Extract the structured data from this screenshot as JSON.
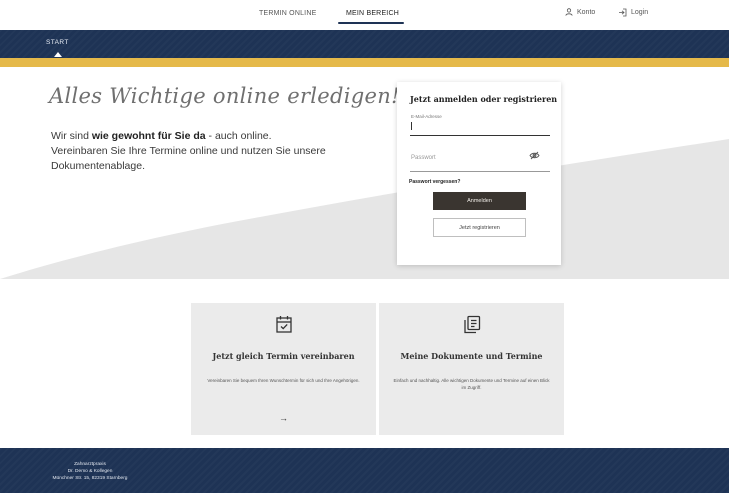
{
  "topnav": {
    "tabs": [
      {
        "label": "TERMIN ONLINE",
        "active": false
      },
      {
        "label": "MEIN BEREICH",
        "active": true
      }
    ],
    "konto_label": "Konto",
    "login_label": "Login"
  },
  "mainnav": {
    "items": [
      {
        "label": "START",
        "active": true
      }
    ]
  },
  "hero": {
    "title": "Alles Wichtige online erledigen!",
    "text_line1_prefix": "Wir sind ",
    "text_line1_bold": "wie gewohnt für Sie da",
    "text_line1_suffix": " - auch online.",
    "text_line2": "Vereinbaren Sie Ihre Termine online und nutzen Sie unsere Dokumentenablage."
  },
  "login": {
    "title": "Jetzt anmelden oder registrieren",
    "email_label": "E-Mail-Adresse",
    "email_value": "",
    "password_placeholder": "Passwort",
    "forgot_label": "Passwort vergessen?",
    "login_button": "Anmelden",
    "register_button": "Jetzt registrieren"
  },
  "cards": [
    {
      "icon": "calendar-check-icon",
      "title": "Jetzt gleich Termin vereinbaren",
      "description": "Vereinbaren Sie bequem Ihren Wunschtermin für sich und Ihre Angehörigen.",
      "arrow": "→"
    },
    {
      "icon": "documents-icon",
      "title": "Meine Dokumente und Termine",
      "description": "Einfach und nachhaltig. Alle wichtigen Dokumente und Termine auf einen Blick im Zugriff.",
      "arrow": ""
    }
  ],
  "footer": {
    "line1": "Zahnarztpraxis",
    "line2": "Dr. Demo & Kollegen",
    "line3": "Münchner Str. 15, 82319 Starnberg"
  },
  "colors": {
    "navy": "#1e3355",
    "gold": "#e5b94a",
    "button_dark": "#3a3530",
    "card_bg": "#ebebeb"
  }
}
